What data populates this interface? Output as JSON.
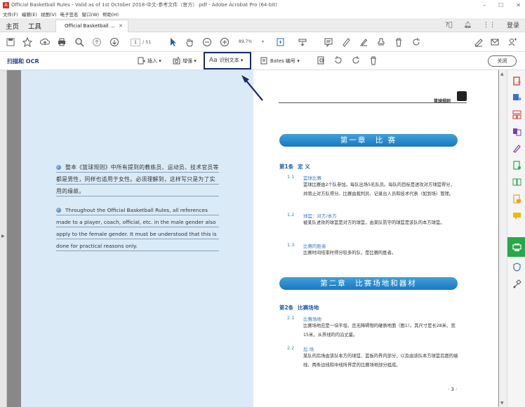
{
  "window": {
    "title": "Official Basketball Rules - Valid as of 1st October 2018-中文-参考文件（官方）.pdf - Adobe Acrobat Pro (64-bit)",
    "controls": [
      "–",
      "☐",
      "✕"
    ]
  },
  "menu": [
    "文件(F)",
    "编辑(E)",
    "视图(V)",
    "电子签名",
    "窗口(W)",
    "帮助(H)"
  ],
  "tabs": {
    "home": "主页",
    "tools": "工具",
    "doc_tab": "Official Basketball ...",
    "login": "登录"
  },
  "toolbar": {
    "page_current": "1",
    "page_total": "/ 51",
    "zoom": "89.7%"
  },
  "scanbar": {
    "label": "扫描和 OCR",
    "insert": "插入 ▾",
    "enhance": "增强 ▾",
    "ocr": "识别文本 ▾",
    "ocr_prefix": "Aa",
    "bates": "Bates 编号 ▾",
    "close": "关闭"
  },
  "left_page": {
    "note_cn": "整本《篮球规则》中所有提到的教练员、运动员、技术官员等都是男性，同样也适用于女性。必须理解到，这样写只是为了实用的缘故。",
    "note_en": "Throughout the Official Basketball Rules, all references made to a player, coach, official, etc. in the male gender also apply to the female gender. It must be understood that this is done for practical reasons only."
  },
  "right_page": {
    "header": "篮球规则",
    "chapter1": "第一章　比 赛",
    "art1": {
      "num": "第1条",
      "title": "定 义"
    },
    "s1_1": {
      "num": "1.1",
      "title": "篮球比赛",
      "text": "篮球比赛由2个队参加，每队出场5名队员。每队的目标是进攻对方球篮得分，并阻止对方队得分。比赛由裁判员、记录台人员和技术代表（如到场）管理。"
    },
    "s1_2": {
      "num": "1.2",
      "title": "球篮：对方/本方",
      "text": "被某队进攻的球篮是对方的球篮，由某队防守的球篮是该队的本方球篮。"
    },
    "s1_3": {
      "num": "1.3",
      "title": "比赛的胜者",
      "text": "比赛时间结束时得分较多的队，是比赛的胜者。"
    },
    "chapter2": "第二章　比赛场地和器材",
    "art2": {
      "num": "第2条",
      "title": "比赛场地"
    },
    "s2_1": {
      "num": "2.1",
      "title": "比赛场地",
      "text": "比赛场地应是一块平坦、且无障碍物的硬质地面（图1）。其尺寸是长28米、宽15米，从界线的内沿丈量。"
    },
    "s2_2": {
      "num": "2.2",
      "title": "后 场",
      "text": "某队的后场由该队本方的球篮、篮板的界内部分，以及由该队本方球篮后面的端线、两条边线和中线所界定的比赛场地部分组成。"
    },
    "page_number": "· 3 ·"
  },
  "colors": {
    "accent_blue": "#1b78bf",
    "ocr_box": "#1a2a6c",
    "active_green": "#27a84a"
  }
}
